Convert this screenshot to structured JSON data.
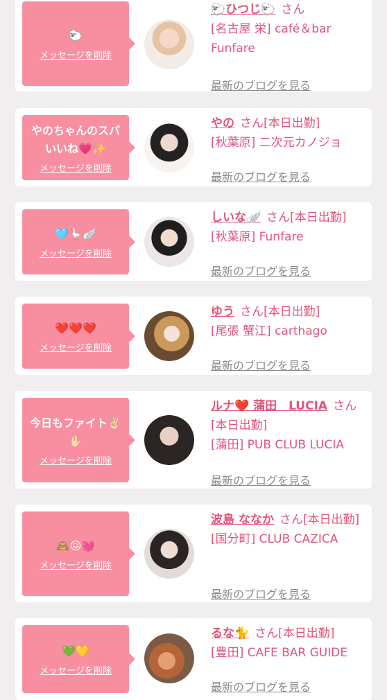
{
  "delete_label": "メッセージを削除",
  "san_label": "さん",
  "blog_label": "最新のブログを見る",
  "colors": {
    "bubble": "#f88fa1",
    "accent": "#e0557a",
    "muted": "#8a8a8a",
    "background": "#f1eeef"
  },
  "cards": [
    {
      "message": "🐑",
      "name": "🐑ひつじ🐑",
      "status": "",
      "shop": "[名古屋 栄] café＆bar Funfare"
    },
    {
      "message": "やのちゃんのスパいいね💗✨",
      "name": "やの",
      "status": "[本日出勤]",
      "shop": "[秋葉原] 二次元カノジョ"
    },
    {
      "message": "🩵🪿🪽",
      "name": "しいな🪽",
      "status": "[本日出勤]",
      "shop": "[秋葉原] Funfare"
    },
    {
      "message": "❤️❤️❤️",
      "name": "ゆう",
      "status": "[本日出勤]",
      "shop": "[尾張 蟹江] carthago"
    },
    {
      "message": "今日もファイト✌🏻✋🏻",
      "name": "ルナ❤️ 蒲田　LUCIA",
      "status": "[本日出勤]",
      "shop": "[蒲田] PUB CLUB LUCIA"
    },
    {
      "message": "🙈😖💓",
      "name": "波島 ななか",
      "status": "[本日出勤]",
      "shop": "[国分町] CLUB CAZICA"
    },
    {
      "message": "💚💛",
      "name": "るな🐈",
      "status": "[本日出勤]",
      "shop": "[豊田] CAFE BAR GUIDE"
    }
  ]
}
